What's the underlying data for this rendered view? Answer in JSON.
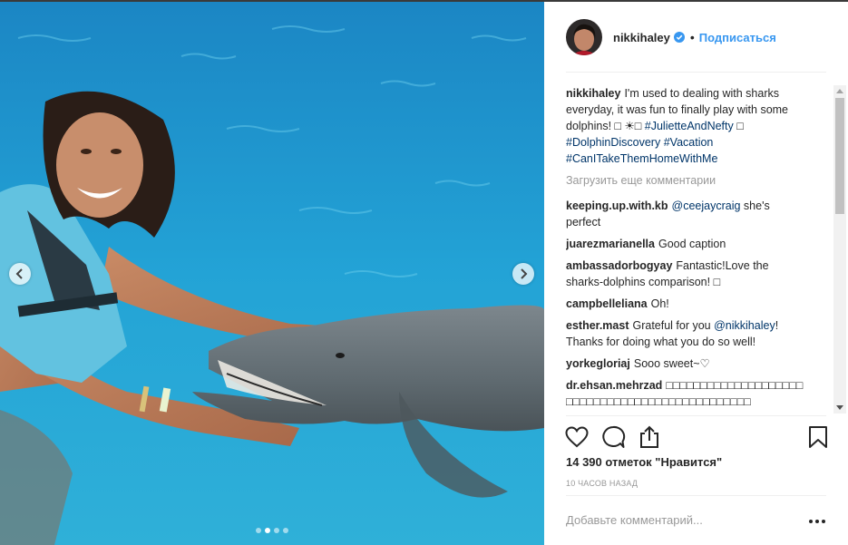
{
  "photo": {
    "prev_icon": "chevron-left-icon",
    "next_icon": "chevron-right-icon",
    "carousel_dots": 4,
    "active_dot": 2
  },
  "header": {
    "username": "nikkihaley",
    "verified_icon": "verified-badge-icon",
    "separator": "•",
    "follow_label": "Подписаться"
  },
  "caption": {
    "username": "nikkihaley",
    "text": "I'm used to dealing with sharks everyday, it was fun to finally play with some dolphins! ",
    "emoji": "□ ☀□",
    "tag1": "#JulietteAndNefty",
    "emoji2": "□",
    "tag2": "#DolphinDiscovery",
    "tag3": "#Vacation",
    "tag4": "#CanITakeThemHomeWithMe"
  },
  "load_more": "Загрузить еще комментарии",
  "comments": [
    {
      "user": "keeping.up.with.kb",
      "mention": "@ceejaycraig",
      "text": " she's perfect"
    },
    {
      "user": "juarezmarianella",
      "text": "Good caption"
    },
    {
      "user": "ambassadorbogyay",
      "text": "Fantastic!Love the sharks-dolphins comparison! □"
    },
    {
      "user": "campbelleliana",
      "text": "Oh!"
    },
    {
      "user": "esther.mast",
      "text_before": "Grateful for you ",
      "mention": "@nikkihaley",
      "text_after": "! Thanks for doing what you do so well!"
    },
    {
      "user": "yorkegloriaj",
      "text": "Sooo sweet~♡"
    },
    {
      "user": "dr.ehsan.mehrzad",
      "text": "□□□□□□□□□□□□□□□□□□□□□□□□□□□□□□□□□□□□□□□□□□□□□□□"
    }
  ],
  "actions": {
    "like_icon": "heart-icon",
    "comment_icon": "comment-icon",
    "share_icon": "share-icon",
    "save_icon": "bookmark-icon"
  },
  "likes": "14 390 отметок \"Нравится\"",
  "time": "10 ЧАСОВ НАЗАД",
  "add_comment_placeholder": "Добавьте комментарий...",
  "more_icon": "more-options-icon",
  "colors": {
    "link": "#3897f0",
    "hashtag": "#003569",
    "muted": "#999999",
    "water": "#1e9ad2"
  }
}
